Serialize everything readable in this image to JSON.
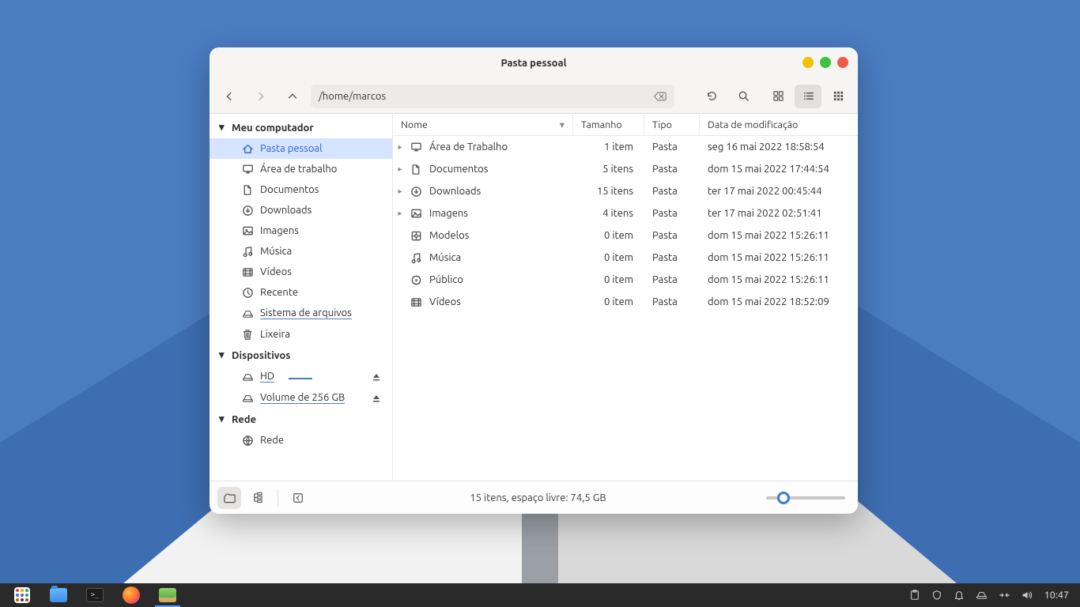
{
  "window": {
    "title": "Pasta pessoal",
    "path": "/home/marcos"
  },
  "sidebar": {
    "sections": {
      "computer": {
        "label": "Meu computador"
      },
      "devices": {
        "label": "Dispositivos"
      },
      "network": {
        "label": "Rede"
      }
    },
    "computer_items": [
      {
        "label": "Pasta pessoal",
        "icon": "home",
        "selected": true
      },
      {
        "label": "Área de trabalho",
        "icon": "desktop"
      },
      {
        "label": "Documentos",
        "icon": "documents"
      },
      {
        "label": "Downloads",
        "icon": "downloads"
      },
      {
        "label": "Imagens",
        "icon": "images"
      },
      {
        "label": "Música",
        "icon": "music"
      },
      {
        "label": "Vídeos",
        "icon": "videos"
      },
      {
        "label": "Recente",
        "icon": "recent"
      },
      {
        "label": "Sistema de arquivos",
        "icon": "disk",
        "underline": true
      },
      {
        "label": "Lixeira",
        "icon": "trash"
      }
    ],
    "device_items": [
      {
        "label": "HD",
        "icon": "disk",
        "eject": true,
        "underline": true,
        "usage": 60
      },
      {
        "label": "Volume de 256 GB",
        "icon": "disk",
        "eject": true,
        "underline": true
      }
    ],
    "network_items": [
      {
        "label": "Rede",
        "icon": "network"
      }
    ]
  },
  "columns": {
    "name": "Nome",
    "size": "Tamanho",
    "type": "Tipo",
    "date": "Data de modificação"
  },
  "rows": [
    {
      "name": "Área de Trabalho",
      "icon": "desktop",
      "expandable": true,
      "size": "1 item",
      "type": "Pasta",
      "date": "seg 16 mai 2022 18:58:54"
    },
    {
      "name": "Documentos",
      "icon": "documents",
      "expandable": true,
      "size": "5 itens",
      "type": "Pasta",
      "date": "dom 15 mai 2022 17:44:54"
    },
    {
      "name": "Downloads",
      "icon": "downloads",
      "expandable": true,
      "size": "15 itens",
      "type": "Pasta",
      "date": "ter 17 mai 2022 00:45:44"
    },
    {
      "name": "Imagens",
      "icon": "images",
      "expandable": true,
      "size": "4 itens",
      "type": "Pasta",
      "date": "ter 17 mai 2022 02:51:41"
    },
    {
      "name": "Modelos",
      "icon": "templates",
      "expandable": false,
      "size": "0 item",
      "type": "Pasta",
      "date": "dom 15 mai 2022 15:26:11"
    },
    {
      "name": "Música",
      "icon": "music",
      "expandable": false,
      "size": "0 item",
      "type": "Pasta",
      "date": "dom 15 mai 2022 15:26:11"
    },
    {
      "name": "Público",
      "icon": "public",
      "expandable": false,
      "size": "0 item",
      "type": "Pasta",
      "date": "dom 15 mai 2022 15:26:11"
    },
    {
      "name": "Vídeos",
      "icon": "videos",
      "expandable": false,
      "size": "0 item",
      "type": "Pasta",
      "date": "dom 15 mai 2022 18:52:09"
    }
  ],
  "status": "15 itens, espaço livre: 74,5 GB",
  "taskbar": {
    "clock": "10:47"
  }
}
